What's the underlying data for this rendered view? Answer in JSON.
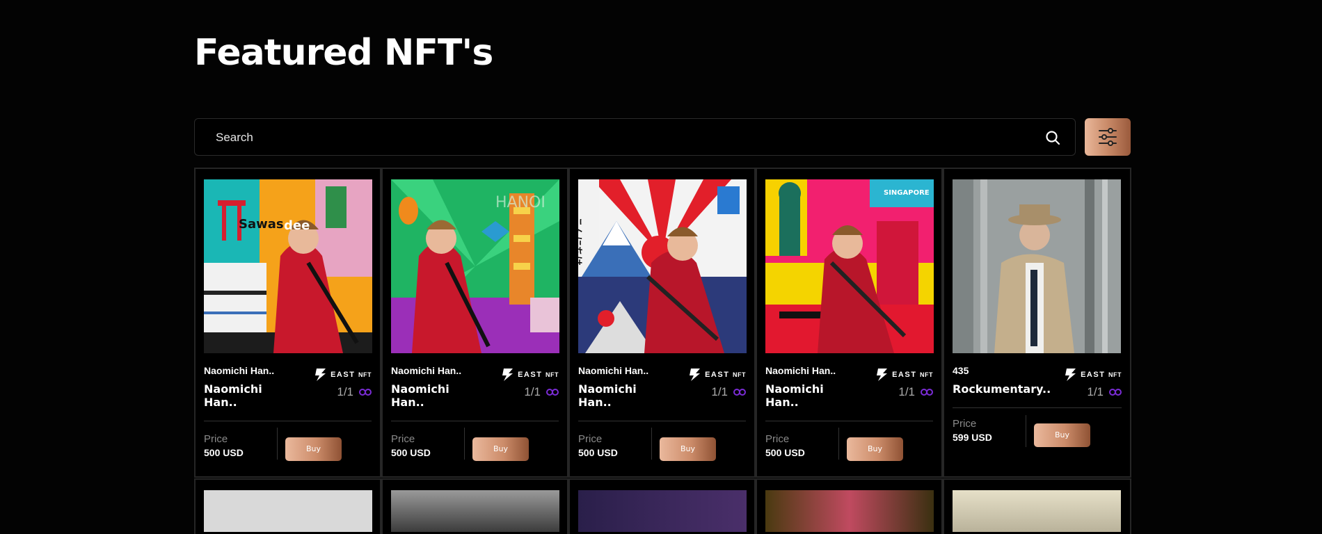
{
  "page": {
    "title": "Featured NFT's"
  },
  "search": {
    "placeholder": "Search"
  },
  "brand": {
    "name": "EAST",
    "suffix": "NFT"
  },
  "labels": {
    "price": "Price",
    "buy": "Buy"
  },
  "colors": {
    "background": "#030303",
    "accent": "#c98a68",
    "link_icon": "#7b2cd6"
  },
  "cards": [
    {
      "creator": "Naomichi Han..",
      "title": "Naomichi Han..",
      "edition": "1/1",
      "price": "500 USD"
    },
    {
      "creator": "Naomichi Han..",
      "title": "Naomichi Han..",
      "edition": "1/1",
      "price": "500 USD"
    },
    {
      "creator": "Naomichi Han..",
      "title": "Naomichi Han..",
      "edition": "1/1",
      "price": "500 USD"
    },
    {
      "creator": "Naomichi Han..",
      "title": "Naomichi Han..",
      "edition": "1/1",
      "price": "500 USD"
    },
    {
      "creator": "435",
      "title": "Rockumentary..",
      "edition": "1/1",
      "price": "599 USD"
    }
  ]
}
